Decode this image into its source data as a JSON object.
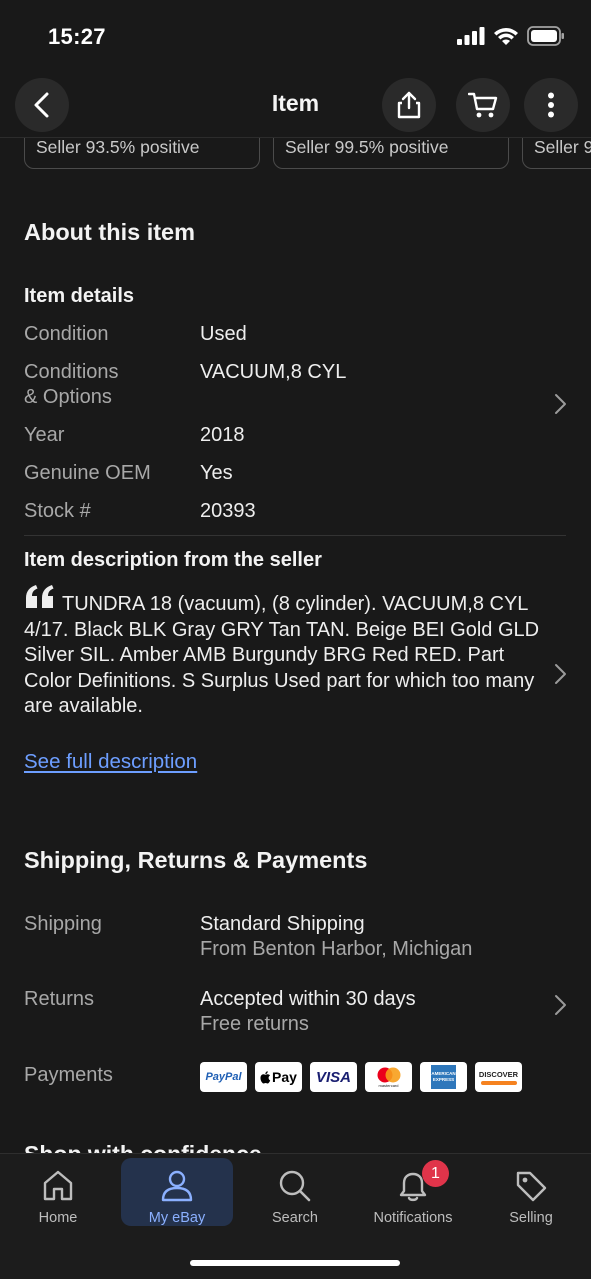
{
  "status": {
    "time": "15:27"
  },
  "nav": {
    "title": "Item"
  },
  "seller_chips": [
    "Seller 93.5% positive",
    "Seller 99.5% positive",
    "Seller 9"
  ],
  "about": {
    "title": "About this item",
    "details_title": "Item details",
    "details": [
      {
        "label": "Condition",
        "value": "Used"
      },
      {
        "label": "Conditions\n& Options",
        "value": "VACUUM,8 CYL"
      },
      {
        "label": "Year",
        "value": "2018"
      },
      {
        "label": "Genuine OEM",
        "value": "Yes"
      },
      {
        "label": "Stock #",
        "value": "20393"
      }
    ],
    "description_title": "Item description from the seller",
    "description": "TUNDRA 18 (vacuum), (8 cylinder). VACUUM,8 CYL 4/17. Black BLK Gray GRY Tan TAN. Beige BEI Gold GLD Silver SIL. Amber AMB Burgundy BRG Red RED. Part Color Definitions. S Surplus Used part for which too many are available.",
    "see_full_label": "See full description"
  },
  "shipping": {
    "title": "Shipping, Returns & Payments",
    "shipping_label": "Shipping",
    "shipping_value": "Standard Shipping",
    "shipping_from": "From Benton Harbor, Michigan",
    "returns_label": "Returns",
    "returns_value": "Accepted within 30 days",
    "returns_note": "Free returns",
    "payments_label": "Payments",
    "payment_methods": [
      "PayPal",
      "Pay",
      "VISA",
      "mastercard",
      "AMERICAN EXPRESS",
      "DISCOVER"
    ]
  },
  "peek": {
    "title": "Shop with confidence"
  },
  "tabs": [
    {
      "label": "Home",
      "icon": "home-icon"
    },
    {
      "label": "My eBay",
      "icon": "person-icon",
      "active": true
    },
    {
      "label": "Search",
      "icon": "search-icon"
    },
    {
      "label": "Notifications",
      "icon": "bell-icon",
      "badge": "1"
    },
    {
      "label": "Selling",
      "icon": "tag-icon"
    }
  ],
  "colors": {
    "background": "#191919",
    "link": "#6d9eff",
    "active_tab": "#24324c",
    "badge": "#e0344a"
  }
}
